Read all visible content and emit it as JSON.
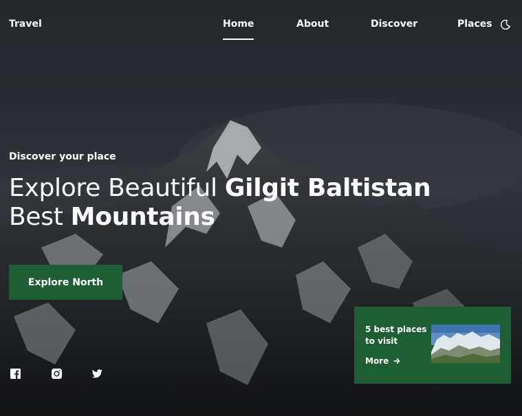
{
  "nav": {
    "logo": "Travel",
    "links": [
      "Home",
      "About",
      "Discover",
      "Places"
    ],
    "active": "Home",
    "theme_icon": "moon-icon"
  },
  "hero": {
    "kicker": "Discover your place",
    "title_line1_light": "Explore Beautiful ",
    "title_line1_bold": "Gilgit Baltistan",
    "title_line2_light": "Best ",
    "title_line2_bold": "Mountains",
    "cta_label": "Explore North"
  },
  "social": [
    "facebook-icon",
    "instagram-icon",
    "twitter-icon"
  ],
  "card": {
    "title": "5 best places to visit",
    "more_label": "More",
    "more_icon": "arrow-right-icon"
  },
  "colors": {
    "accent": "#1d5e35",
    "sky": "#2a2f36",
    "text": "#ffffff"
  }
}
